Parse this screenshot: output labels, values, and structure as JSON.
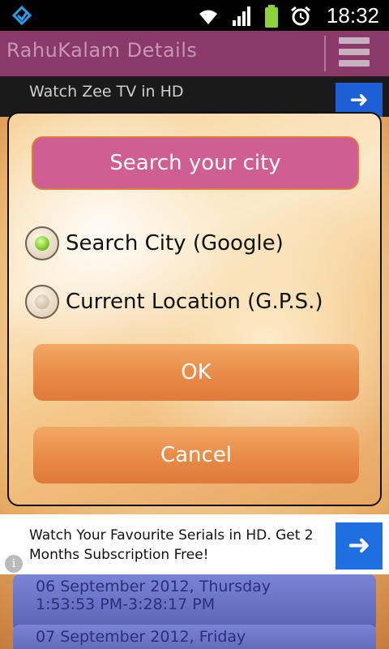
{
  "status_bar": {
    "time": "18:32",
    "icons": [
      "app-notification-icon",
      "wifi-icon",
      "signal-icon",
      "battery-icon",
      "alarm-icon"
    ]
  },
  "action_bar": {
    "title": "RahuKalam Details",
    "menu_icon": "menu-icon"
  },
  "ad_top": {
    "text": "Watch Zee TV in HD"
  },
  "dialog": {
    "search_button_label": "Search your city",
    "options": [
      {
        "label": "Search City (Google)",
        "selected": true
      },
      {
        "label": "Current Location (G.P.S.)",
        "selected": false
      }
    ],
    "ok_label": "OK",
    "cancel_label": "Cancel"
  },
  "ad_bottom": {
    "text": "Watch Your Favourite Serials in HD. Get 2 Months Subscription Free!",
    "info_label": "i"
  },
  "list": [
    {
      "date": "06 September 2012, Thursday",
      "time": "1:53:53 PM-3:28:17 PM"
    },
    {
      "date": "07 September 2012, Friday",
      "time": ""
    }
  ],
  "colors": {
    "action_bar": "#8a3a6a",
    "search_button": "#cf5e93",
    "ok_cancel": "#e88a48",
    "ad_arrow": "#1f6fe0"
  }
}
